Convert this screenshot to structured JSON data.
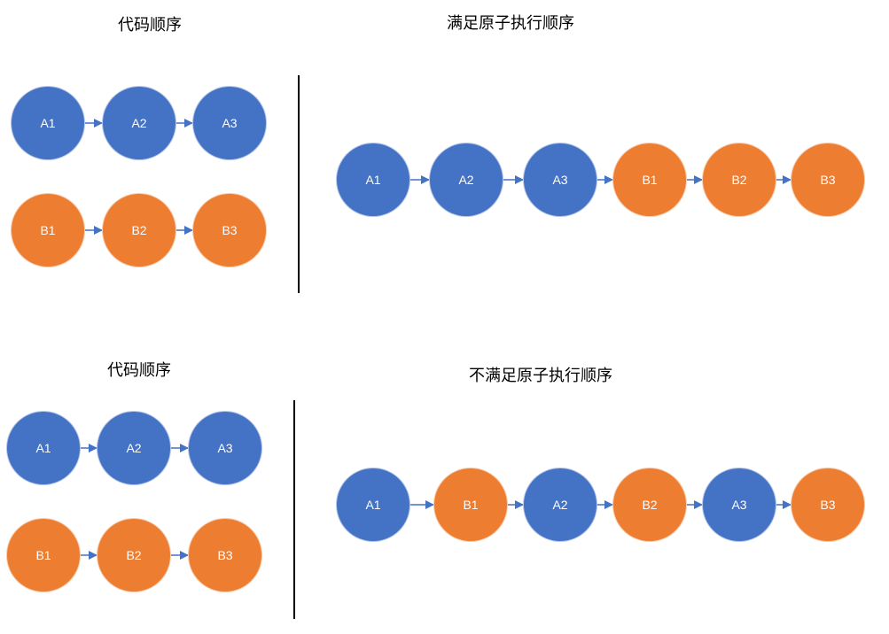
{
  "colors": {
    "A": "#4472C4",
    "B": "#ED7D31",
    "arrow": "#4472C4",
    "divider": "#000000"
  },
  "diagram1": {
    "code_order_title": "代码顺序",
    "exec_title": "满足原子执行顺序",
    "code_row_a": [
      "A1",
      "A2",
      "A3"
    ],
    "code_row_b": [
      "B1",
      "B2",
      "B3"
    ],
    "exec_row": [
      "A1",
      "A2",
      "A3",
      "B1",
      "B2",
      "B3"
    ]
  },
  "diagram2": {
    "code_order_title": "代码顺序",
    "exec_title": "不满足原子执行顺序",
    "code_row_a": [
      "A1",
      "A2",
      "A3"
    ],
    "code_row_b": [
      "B1",
      "B2",
      "B3"
    ],
    "exec_row": [
      "A1",
      "B1",
      "A2",
      "B2",
      "A3",
      "B3"
    ]
  }
}
